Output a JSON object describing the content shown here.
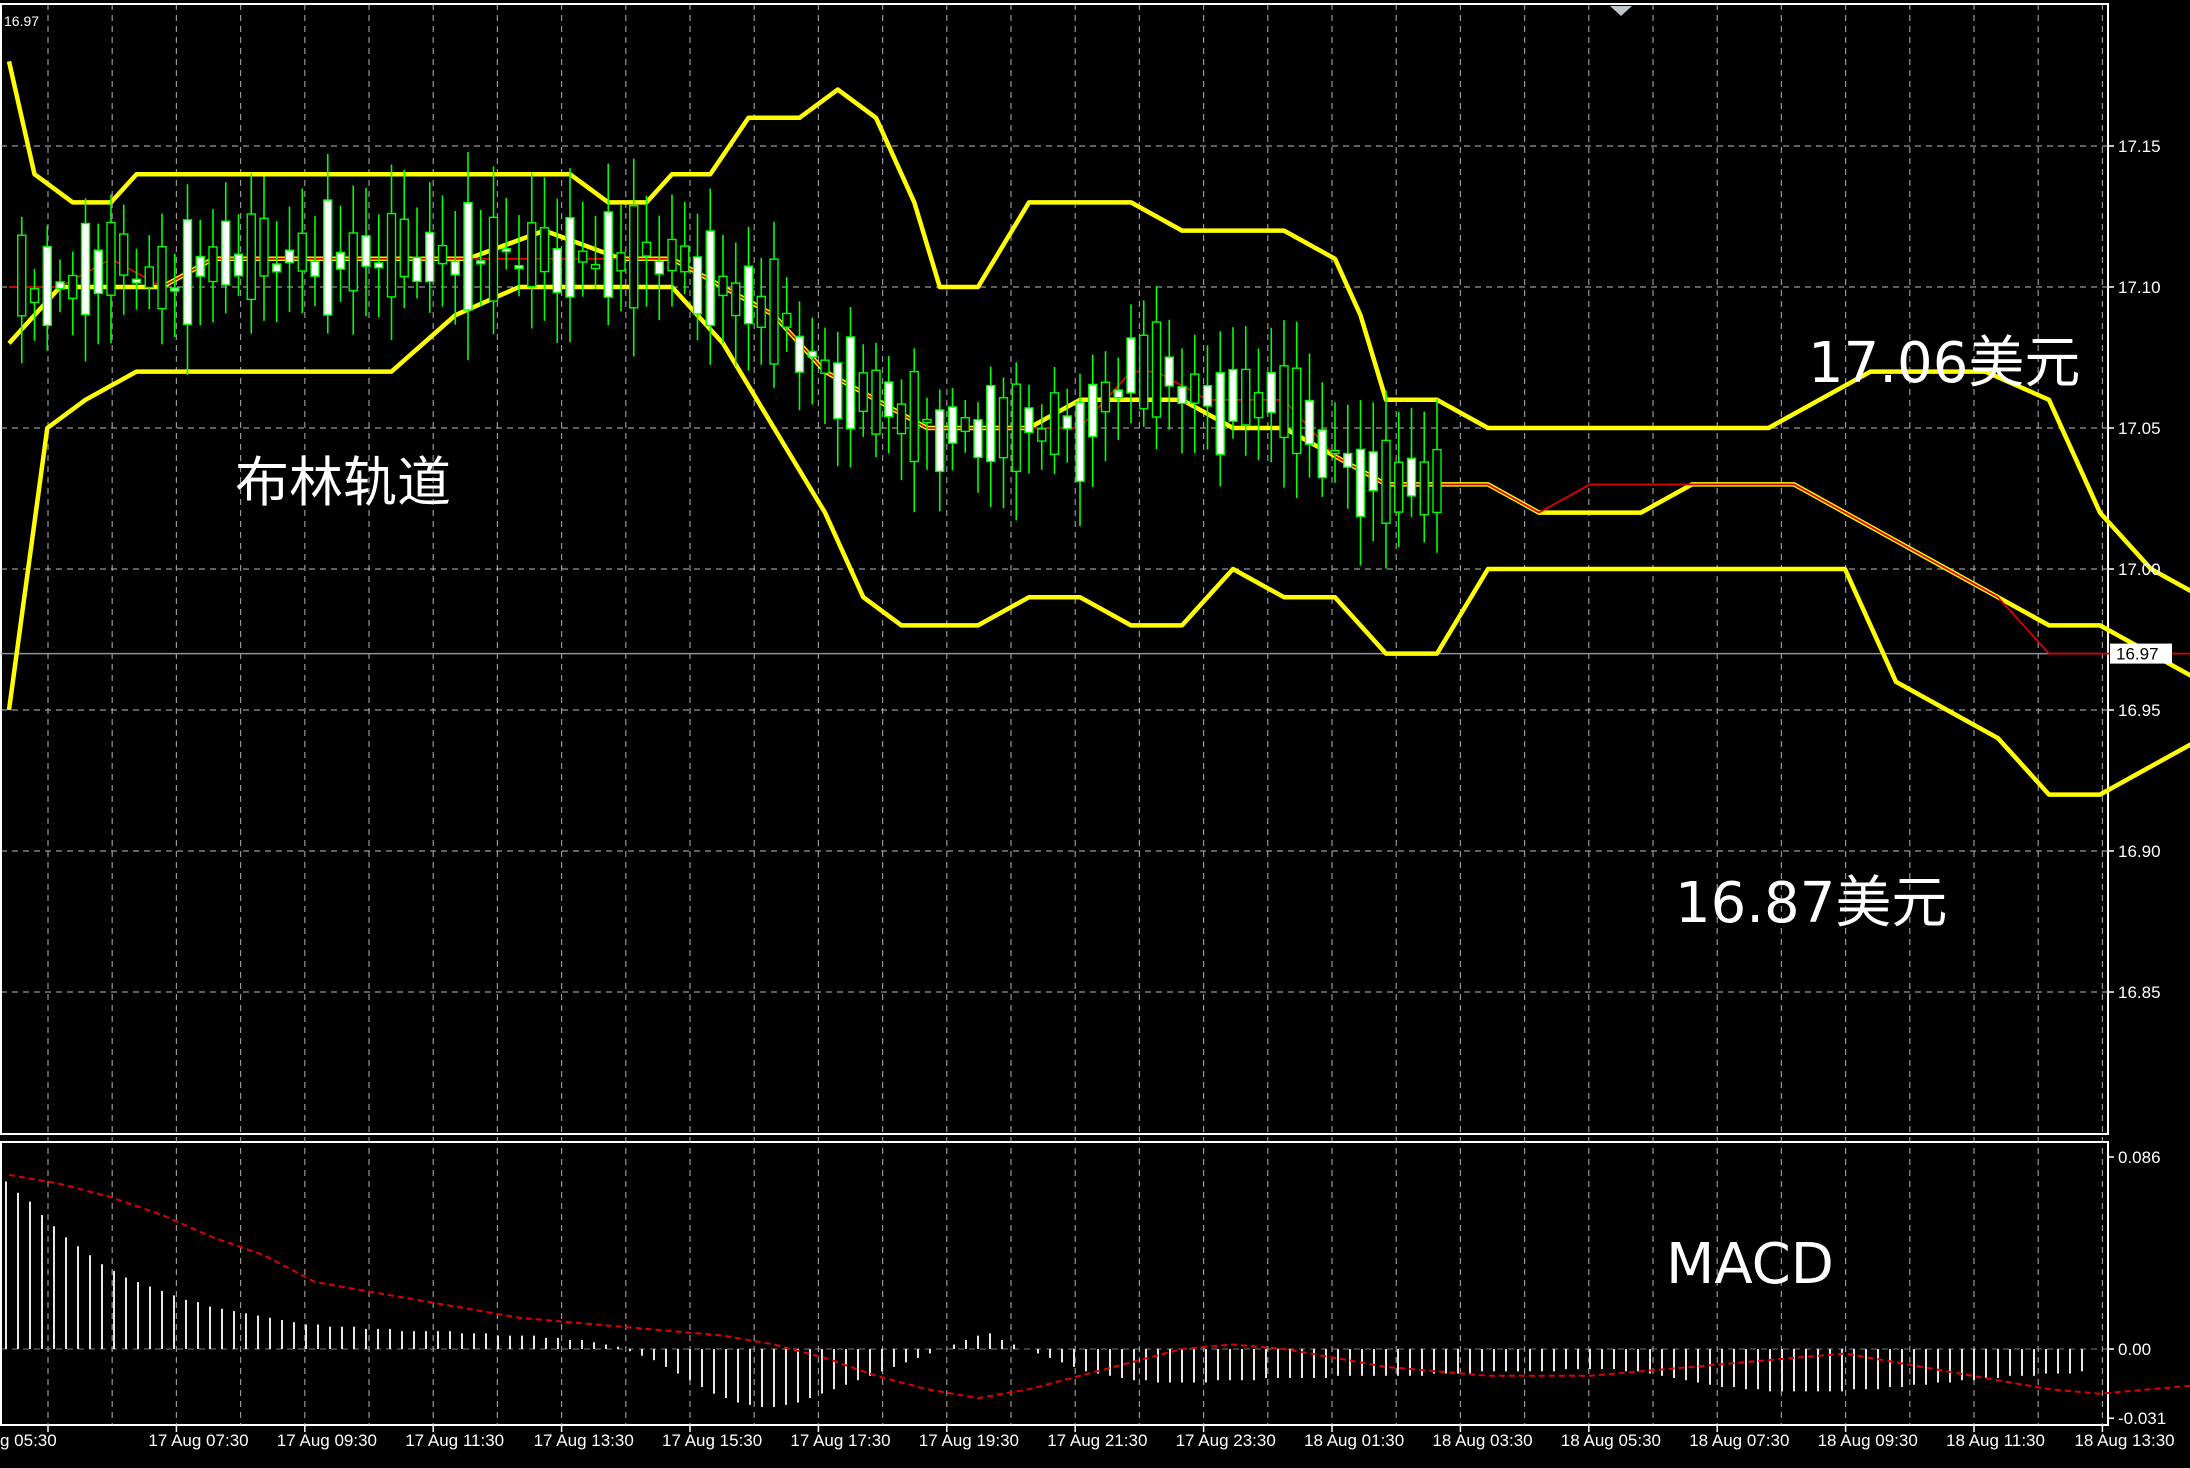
{
  "chart_data": {
    "type": "candlestick",
    "title": "",
    "current_price": 16.97,
    "corner_label": "16.97",
    "colors": {
      "background": "#000000",
      "bull": "#ffffff",
      "bear": "#000000",
      "wick": "#00ff00",
      "bands": "#ffff00",
      "ma": "#e00000",
      "grid": "#c8c8c8",
      "axis_text": "#ffffff",
      "current_line": "#8a94a0"
    },
    "price_axis": {
      "ticks": [
        17.15,
        17.1,
        17.05,
        17.0,
        16.95,
        16.9,
        16.85
      ],
      "tick_labels": [
        "17.15",
        "17.10",
        "17.05",
        "17.00",
        "16.95",
        "16.90",
        "16.85"
      ],
      "range": [
        16.8,
        17.2
      ]
    },
    "time_axis": {
      "labels": [
        "g 05:30",
        "17 Aug 07:30",
        "17 Aug 09:30",
        "17 Aug 11:30",
        "17 Aug 13:30",
        "17 Aug 15:30",
        "17 Aug 17:30",
        "17 Aug 19:30",
        "17 Aug 21:30",
        "17 Aug 23:30",
        "18 Aug 01:30",
        "18 Aug 03:30",
        "18 Aug 05:30",
        "18 Aug 07:30",
        "18 Aug 09:30",
        "18 Aug 11:30",
        "18 Aug 13:30"
      ]
    },
    "bollinger": {
      "upper": [
        [
          0,
          17.18
        ],
        [
          2,
          17.14
        ],
        [
          5,
          17.13
        ],
        [
          8,
          17.13
        ],
        [
          10,
          17.14
        ],
        [
          15,
          17.14
        ],
        [
          20,
          17.14
        ],
        [
          25,
          17.14
        ],
        [
          28,
          17.14
        ],
        [
          33,
          17.14
        ],
        [
          36,
          17.14
        ],
        [
          40,
          17.14
        ],
        [
          44,
          17.14
        ],
        [
          47,
          17.13
        ],
        [
          50,
          17.13
        ],
        [
          52,
          17.14
        ],
        [
          55,
          17.14
        ],
        [
          58,
          17.16
        ],
        [
          62,
          17.16
        ],
        [
          65,
          17.17
        ],
        [
          68,
          17.16
        ],
        [
          71,
          17.13
        ],
        [
          73,
          17.1
        ],
        [
          76,
          17.1
        ],
        [
          80,
          17.13
        ],
        [
          84,
          17.13
        ],
        [
          88,
          17.13
        ],
        [
          92,
          17.12
        ],
        [
          96,
          17.12
        ],
        [
          100,
          17.12
        ],
        [
          104,
          17.11
        ],
        [
          106,
          17.09
        ],
        [
          108,
          17.06
        ],
        [
          112,
          17.06
        ],
        [
          116,
          17.05
        ],
        [
          120,
          17.05
        ],
        [
          124,
          17.05
        ],
        [
          128,
          17.05
        ],
        [
          130,
          17.05
        ],
        [
          134,
          17.05
        ],
        [
          138,
          17.05
        ],
        [
          142,
          17.06
        ],
        [
          146,
          17.07
        ],
        [
          150,
          17.07
        ],
        [
          155,
          17.07
        ],
        [
          160,
          17.06
        ],
        [
          164,
          17.02
        ],
        [
          168,
          17.0
        ],
        [
          172,
          16.99
        ]
      ],
      "middle": [
        [
          0,
          17.08
        ],
        [
          4,
          17.1
        ],
        [
          8,
          17.1
        ],
        [
          12,
          17.1
        ],
        [
          16,
          17.11
        ],
        [
          20,
          17.11
        ],
        [
          25,
          17.11
        ],
        [
          30,
          17.11
        ],
        [
          36,
          17.11
        ],
        [
          42,
          17.12
        ],
        [
          48,
          17.11
        ],
        [
          52,
          17.11
        ],
        [
          56,
          17.1
        ],
        [
          60,
          17.09
        ],
        [
          64,
          17.07
        ],
        [
          68,
          17.06
        ],
        [
          72,
          17.05
        ],
        [
          76,
          17.05
        ],
        [
          80,
          17.05
        ],
        [
          84,
          17.06
        ],
        [
          88,
          17.06
        ],
        [
          92,
          17.06
        ],
        [
          96,
          17.05
        ],
        [
          100,
          17.05
        ],
        [
          104,
          17.04
        ],
        [
          108,
          17.03
        ],
        [
          112,
          17.03
        ],
        [
          116,
          17.03
        ],
        [
          120,
          17.02
        ],
        [
          124,
          17.02
        ],
        [
          128,
          17.02
        ],
        [
          132,
          17.03
        ],
        [
          136,
          17.03
        ],
        [
          140,
          17.03
        ],
        [
          144,
          17.02
        ],
        [
          148,
          17.01
        ],
        [
          152,
          17.0
        ],
        [
          156,
          16.99
        ],
        [
          160,
          16.98
        ],
        [
          164,
          16.98
        ],
        [
          168,
          16.97
        ],
        [
          172,
          16.96
        ]
      ],
      "lower": [
        [
          0,
          16.95
        ],
        [
          3,
          17.05
        ],
        [
          6,
          17.06
        ],
        [
          10,
          17.07
        ],
        [
          15,
          17.07
        ],
        [
          20,
          17.07
        ],
        [
          25,
          17.07
        ],
        [
          30,
          17.07
        ],
        [
          35,
          17.09
        ],
        [
          40,
          17.1
        ],
        [
          44,
          17.1
        ],
        [
          48,
          17.1
        ],
        [
          52,
          17.1
        ],
        [
          56,
          17.08
        ],
        [
          60,
          17.05
        ],
        [
          64,
          17.02
        ],
        [
          67,
          16.99
        ],
        [
          70,
          16.98
        ],
        [
          72,
          16.98
        ],
        [
          76,
          16.98
        ],
        [
          80,
          16.99
        ],
        [
          84,
          16.99
        ],
        [
          88,
          16.98
        ],
        [
          92,
          16.98
        ],
        [
          96,
          17.0
        ],
        [
          100,
          16.99
        ],
        [
          104,
          16.99
        ],
        [
          108,
          16.97
        ],
        [
          112,
          16.97
        ],
        [
          116,
          17.0
        ],
        [
          120,
          17.0
        ],
        [
          124,
          17.0
        ],
        [
          128,
          17.0
        ],
        [
          132,
          17.0
        ],
        [
          136,
          17.0
        ],
        [
          140,
          17.0
        ],
        [
          144,
          17.0
        ],
        [
          148,
          16.96
        ],
        [
          152,
          16.95
        ],
        [
          156,
          16.94
        ],
        [
          160,
          16.92
        ],
        [
          164,
          16.92
        ],
        [
          168,
          16.93
        ],
        [
          172,
          16.94
        ]
      ]
    },
    "ma": [
      [
        0,
        17.1
      ],
      [
        4,
        17.1
      ],
      [
        8,
        17.11
      ],
      [
        12,
        17.1
      ],
      [
        16,
        17.11
      ],
      [
        20,
        17.11
      ],
      [
        26,
        17.11
      ],
      [
        32,
        17.11
      ],
      [
        36,
        17.11
      ],
      [
        42,
        17.11
      ],
      [
        48,
        17.11
      ],
      [
        52,
        17.11
      ],
      [
        56,
        17.1
      ],
      [
        60,
        17.09
      ],
      [
        64,
        17.07
      ],
      [
        68,
        17.06
      ],
      [
        72,
        17.05
      ],
      [
        76,
        17.05
      ],
      [
        80,
        17.05
      ],
      [
        84,
        17.05
      ],
      [
        88,
        17.07
      ],
      [
        90,
        17.07
      ],
      [
        94,
        17.06
      ],
      [
        100,
        17.06
      ],
      [
        104,
        17.04
      ],
      [
        108,
        17.03
      ],
      [
        112,
        17.03
      ],
      [
        116,
        17.03
      ],
      [
        120,
        17.02
      ],
      [
        124,
        17.03
      ],
      [
        128,
        17.03
      ],
      [
        132,
        17.03
      ],
      [
        136,
        17.03
      ],
      [
        140,
        17.03
      ],
      [
        144,
        17.02
      ],
      [
        148,
        17.01
      ],
      [
        152,
        17.0
      ],
      [
        156,
        16.99
      ],
      [
        160,
        16.97
      ],
      [
        164,
        16.97
      ],
      [
        168,
        16.97
      ],
      [
        172,
        16.97
      ]
    ],
    "macd": {
      "axis_ticks": [
        0.086,
        0.0,
        -0.031
      ],
      "tick_labels": [
        "0.086",
        "0.00",
        "-0.031"
      ],
      "histogram": [
        0.075,
        0.07,
        0.066,
        0.06,
        0.055,
        0.05,
        0.046,
        0.042,
        0.038,
        0.035,
        0.032,
        0.03,
        0.028,
        0.026,
        0.024,
        0.022,
        0.021,
        0.019,
        0.018,
        0.017,
        0.016,
        0.015,
        0.014,
        0.013,
        0.012,
        0.011,
        0.011,
        0.01,
        0.01,
        0.01,
        0.009,
        0.009,
        0.009,
        0.008,
        0.008,
        0.008,
        0.008,
        0.008,
        0.007,
        0.007,
        0.007,
        0.006,
        0.006,
        0.006,
        0.006,
        0.005,
        0.005,
        0.004,
        0.004,
        0.003,
        0.002,
        0.001,
        -0.001,
        -0.003,
        -0.005,
        -0.008,
        -0.011,
        -0.014,
        -0.017,
        -0.02,
        -0.022,
        -0.024,
        -0.025,
        -0.026,
        -0.026,
        -0.025,
        -0.024,
        -0.022,
        -0.02,
        -0.018,
        -0.016,
        -0.014,
        -0.012,
        -0.01,
        -0.008,
        -0.006,
        -0.004,
        -0.002,
        0.0,
        0.002,
        0.004,
        0.006,
        0.007,
        0.004,
        0.002,
        0.0,
        -0.002,
        -0.004,
        -0.006,
        -0.008,
        -0.01,
        -0.011,
        -0.012,
        -0.013,
        -0.014,
        -0.014,
        -0.015,
        -0.015,
        -0.015,
        -0.015,
        -0.015,
        -0.014,
        -0.014,
        -0.014,
        -0.014,
        -0.013,
        -0.013,
        -0.013,
        -0.013,
        -0.013,
        -0.013,
        -0.012,
        -0.012,
        -0.012,
        -0.012,
        -0.012,
        -0.012,
        -0.012,
        -0.012,
        -0.011,
        -0.011,
        -0.011,
        -0.011,
        -0.01,
        -0.01,
        -0.01,
        -0.01,
        -0.01,
        -0.01,
        -0.01,
        -0.009,
        -0.009,
        -0.009,
        -0.009,
        -0.009,
        -0.01,
        -0.01,
        -0.011,
        -0.012,
        -0.013,
        -0.014,
        -0.015,
        -0.016,
        -0.017,
        -0.017,
        -0.018,
        -0.018,
        -0.019,
        -0.019,
        -0.019,
        -0.019,
        -0.019,
        -0.019,
        -0.019,
        -0.018,
        -0.018,
        -0.018,
        -0.017,
        -0.017,
        -0.016,
        -0.016,
        -0.015,
        -0.015,
        -0.014,
        -0.014,
        -0.013,
        -0.013,
        -0.012,
        -0.012,
        -0.012,
        -0.011,
        -0.011,
        -0.011,
        -0.01
      ],
      "signal": [
        [
          0,
          0.078
        ],
        [
          4,
          0.074
        ],
        [
          8,
          0.068
        ],
        [
          12,
          0.06
        ],
        [
          16,
          0.05
        ],
        [
          20,
          0.042
        ],
        [
          24,
          0.03
        ],
        [
          28,
          0.026
        ],
        [
          32,
          0.022
        ],
        [
          36,
          0.018
        ],
        [
          40,
          0.014
        ],
        [
          44,
          0.012
        ],
        [
          48,
          0.01
        ],
        [
          52,
          0.008
        ],
        [
          56,
          0.006
        ],
        [
          60,
          0.002
        ],
        [
          64,
          -0.004
        ],
        [
          68,
          -0.012
        ],
        [
          72,
          -0.018
        ],
        [
          76,
          -0.022
        ],
        [
          80,
          -0.018
        ],
        [
          84,
          -0.012
        ],
        [
          88,
          -0.006
        ],
        [
          92,
          0.0
        ],
        [
          96,
          0.002
        ],
        [
          100,
          0.0
        ],
        [
          104,
          -0.004
        ],
        [
          108,
          -0.008
        ],
        [
          112,
          -0.01
        ],
        [
          116,
          -0.012
        ],
        [
          120,
          -0.012
        ],
        [
          124,
          -0.012
        ],
        [
          128,
          -0.01
        ],
        [
          132,
          -0.008
        ],
        [
          136,
          -0.006
        ],
        [
          140,
          -0.004
        ],
        [
          144,
          -0.002
        ],
        [
          148,
          -0.006
        ],
        [
          152,
          -0.01
        ],
        [
          156,
          -0.014
        ],
        [
          160,
          -0.018
        ],
        [
          164,
          -0.02
        ],
        [
          168,
          -0.018
        ],
        [
          172,
          -0.016
        ]
      ]
    }
  },
  "annotations": {
    "bollinger": "布林轨道",
    "upper_price": "17.06美元",
    "lower_price": "16.87美元",
    "macd": "MACD"
  }
}
